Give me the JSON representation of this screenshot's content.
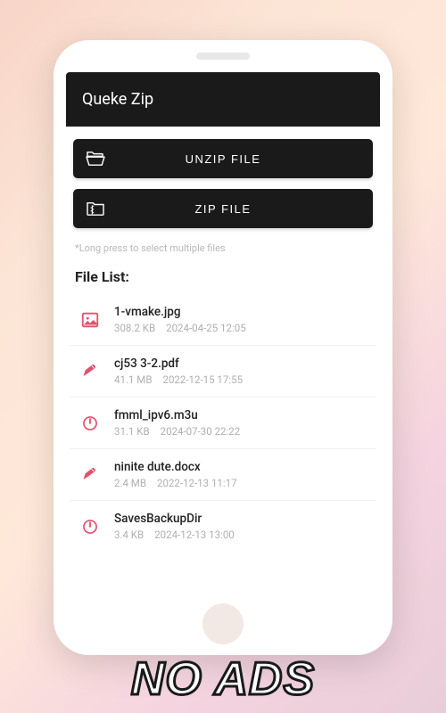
{
  "app": {
    "title": "Queke Zip"
  },
  "actions": {
    "unzip_label": "UNZIP FILE",
    "zip_label": "ZIP FILE"
  },
  "hint": "*Long press to select multiple files",
  "list_title": "File List:",
  "colors": {
    "accent": "#e2526e"
  },
  "files": [
    {
      "icon": "image",
      "name": "1-vmake.jpg",
      "size": "308.2 KB",
      "date": "2024-04-25 12:05"
    },
    {
      "icon": "pencil",
      "name": "cj53 3-2.pdf",
      "size": "41.1 MB",
      "date": "2022-12-15 17:55"
    },
    {
      "icon": "power",
      "name": "fmml_ipv6.m3u",
      "size": "31.1 KB",
      "date": "2024-07-30 22:22"
    },
    {
      "icon": "pencil",
      "name": "ninite dute.docx",
      "size": "2.4 MB",
      "date": "2022-12-13 11:17"
    },
    {
      "icon": "power",
      "name": "SavesBackupDir",
      "size": "3.4 KB",
      "date": "2024-12-13 13:00"
    }
  ],
  "promo": "NO ADS"
}
